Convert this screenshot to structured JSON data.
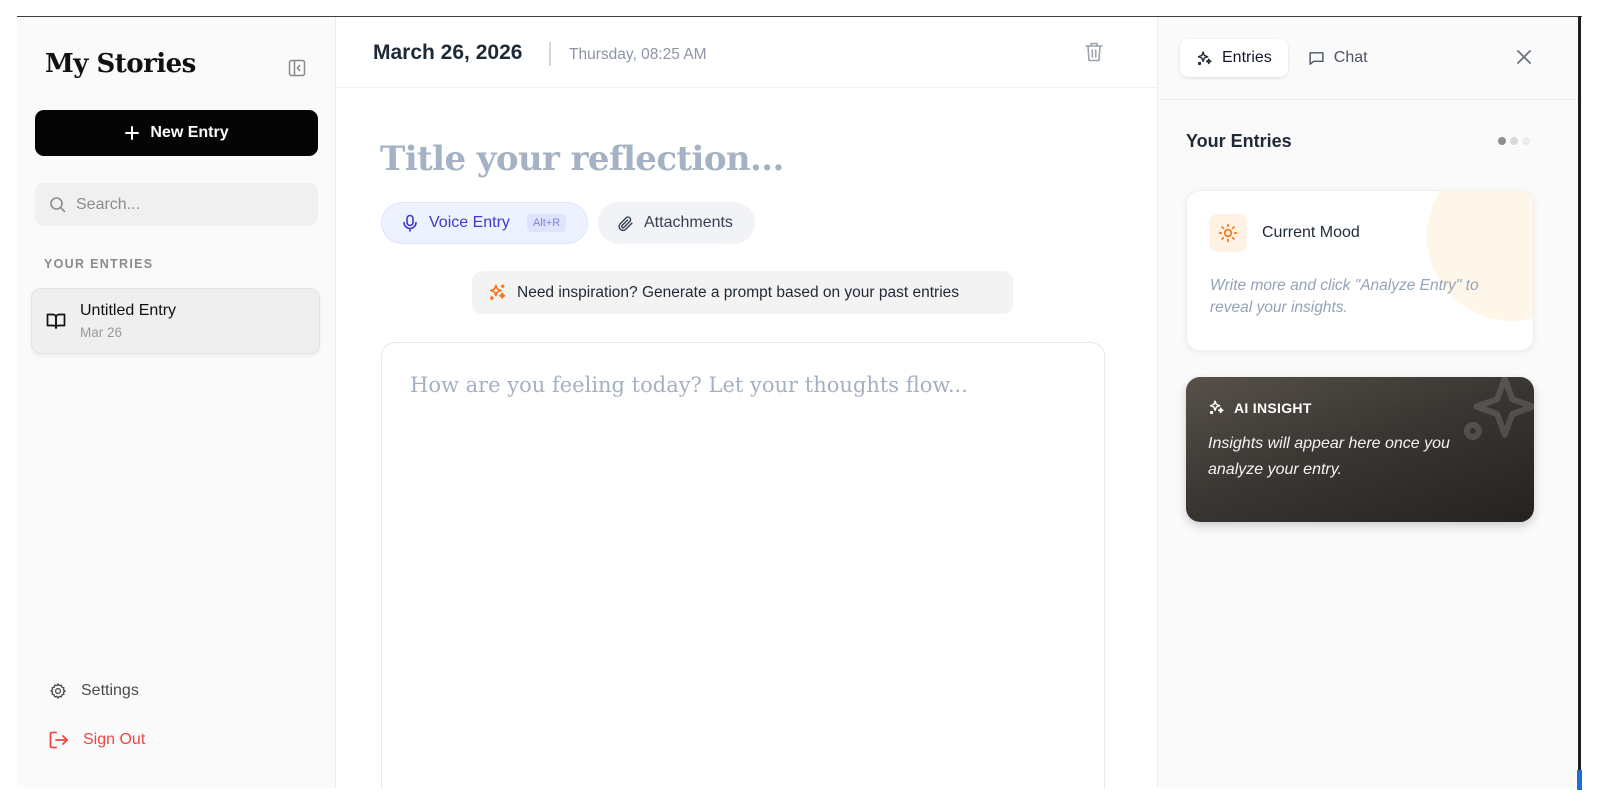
{
  "sidebar": {
    "brand": "My Stories",
    "new_entry_label": "New Entry",
    "search_placeholder": "Search...",
    "section_label": "YOUR ENTRIES",
    "entries": [
      {
        "title": "Untitled Entry",
        "date": "Mar 26"
      }
    ],
    "settings_label": "Settings",
    "signout_label": "Sign Out"
  },
  "main": {
    "date": "March 26, 2026",
    "day_time": "Thursday, 08:25 AM",
    "title_placeholder": "Title your reflection...",
    "voice_label": "Voice Entry",
    "voice_shortcut": "Alt+R",
    "attachments_label": "Attachments",
    "inspiration_label": "Need inspiration? Generate a prompt based on your past entries",
    "editor_placeholder": "How are you feeling today? Let your thoughts flow..."
  },
  "right_panel": {
    "tabs": [
      {
        "label": "Entries",
        "icon": "sparkles-icon",
        "active": true
      },
      {
        "label": "Chat",
        "icon": "chat-bubble-icon",
        "active": false
      }
    ],
    "title": "Your Entries",
    "mood": {
      "title": "Current Mood",
      "text": "Write more and click \"Analyze Entry\" to reveal your insights."
    },
    "insight": {
      "label": "AI INSIGHT",
      "text": "Insights will appear here once you analyze your entry."
    }
  },
  "colors": {
    "accent_dark": "#050505",
    "voice_accent": "#4338ca",
    "danger": "#ef4444",
    "mood_accent": "#f97316",
    "placeholder": "#a4b2c4"
  }
}
